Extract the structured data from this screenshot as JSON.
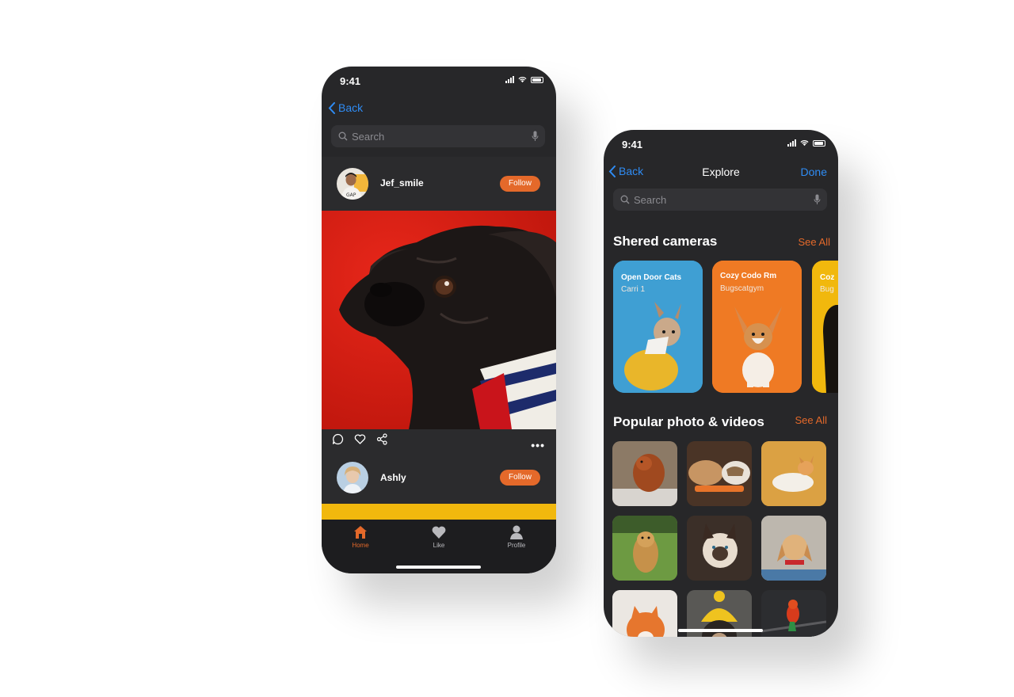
{
  "feed_screen": {
    "status": {
      "time": "9:41"
    },
    "nav": {
      "back_label": "Back"
    },
    "search": {
      "placeholder": "Search"
    },
    "posts": [
      {
        "username": "Jef_smile",
        "follow_label": "Follow"
      },
      {
        "username": "Ashly",
        "follow_label": "Follow"
      }
    ],
    "post_actions": {
      "more": "•••"
    },
    "tabs": [
      {
        "label": "Home",
        "icon": "home-icon",
        "active": true
      },
      {
        "label": "Like",
        "icon": "heart-icon",
        "active": false
      },
      {
        "label": "Profile",
        "icon": "profile-icon",
        "active": false
      }
    ]
  },
  "explore_screen": {
    "status": {
      "time": "9:41"
    },
    "nav": {
      "back_label": "Back",
      "title": "Explore",
      "done_label": "Done"
    },
    "search": {
      "placeholder": "Search"
    },
    "shared_cameras": {
      "title": "Shered cameras",
      "see_all": "See All",
      "cards": [
        {
          "title": "Open Door Cats",
          "subtitle": "Carri 1",
          "color": "#3e9bd0"
        },
        {
          "title": "Cozy Codo Rm",
          "subtitle": "Bugscatgym",
          "color": "#ef7a24"
        },
        {
          "title": "Coz",
          "subtitle": "Bug",
          "color": "#f1b80d"
        }
      ]
    },
    "popular": {
      "title": "Popular photo & videos",
      "see_all": "See All"
    }
  },
  "colors": {
    "accent": "#e4692a",
    "link": "#2f8cf4",
    "background": "#272729"
  }
}
